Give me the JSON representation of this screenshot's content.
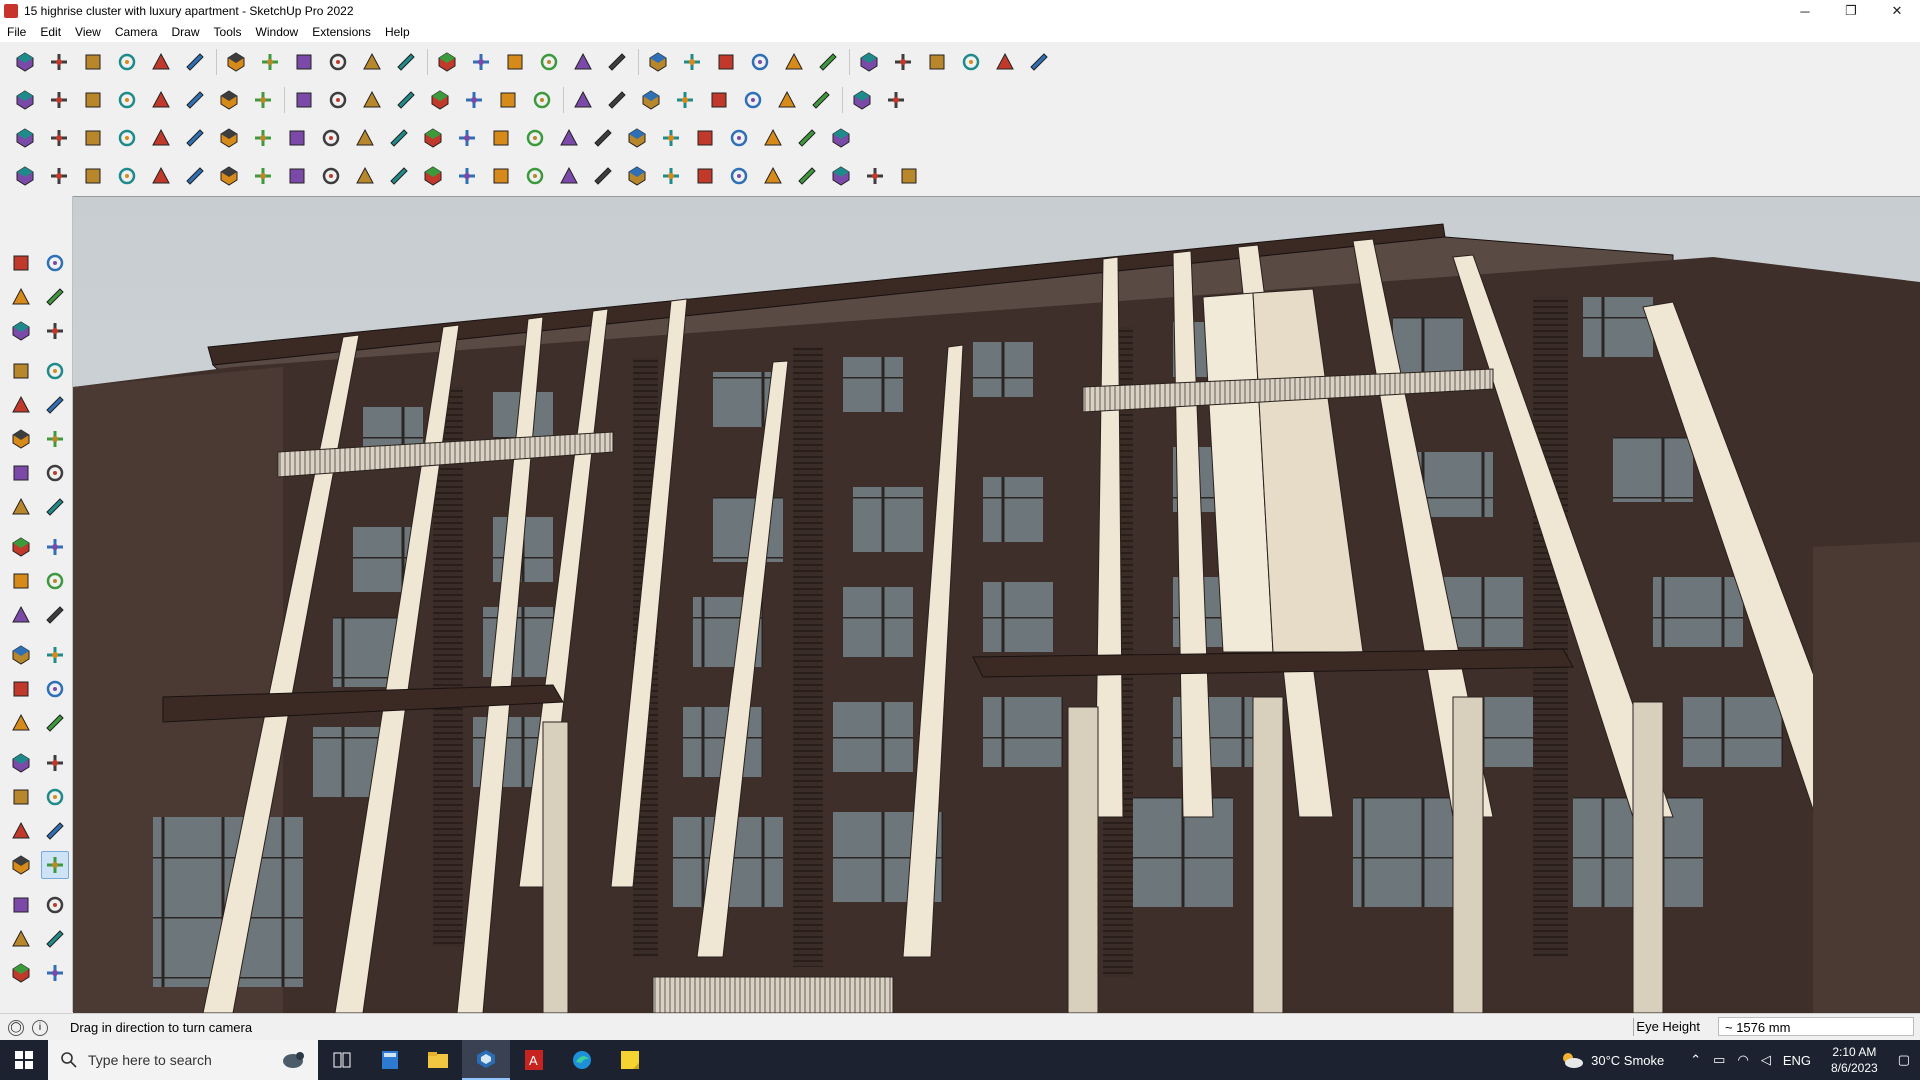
{
  "window": {
    "title": "15 highrise cluster with luxury apartment - SketchUp Pro 2022",
    "minimize_glyph": "─",
    "maximize_glyph": "❐",
    "close_glyph": "✕"
  },
  "menu": [
    "File",
    "Edit",
    "View",
    "Camera",
    "Draw",
    "Tools",
    "Window",
    "Extensions",
    "Help"
  ],
  "toolbar_icons": {
    "row1": [
      "zoom-icon",
      "select-icon",
      "eraser-icon",
      "pencil-icon",
      "lasso-icon",
      "rectangle-icon",
      "push-pull-icon",
      "follow-me-icon",
      "move-icon",
      "rotate-icon",
      "scale-icon",
      "tape-measure-icon",
      "text-icon",
      "paint-bucket-icon",
      "orbit-icon",
      "pan-icon",
      "zoom-window-icon",
      "zoom-extents-icon",
      "section-plane-icon",
      "section-display-icon",
      "layers-icon",
      "styles-icon",
      "components-icon",
      "geo-location-icon",
      "warehouse-icon",
      "extension-manager-icon",
      "send-to-layout-icon",
      "undo-icon",
      "redo-icon",
      "solid-tools-icon"
    ],
    "row2": [
      "iso-view-icon",
      "top-view-icon",
      "front-view-icon",
      "right-view-icon",
      "back-view-icon",
      "left-view-icon",
      "x-ray-icon",
      "wireframe-icon",
      "hidden-line-icon",
      "shaded-icon",
      "textured-icon",
      "monochrome-icon",
      "house-icon",
      "roof-icon",
      "garage-icon",
      "shadow-icon",
      "fog-icon",
      "circle-icon",
      "polygon-icon",
      "arc-icon",
      "curve-icon",
      "offset-icon",
      "intersect-icon",
      "subtract-icon",
      "split-icon",
      "trim-icon"
    ],
    "row3": [
      "cube-blue-icon",
      "plane-blue-icon",
      "plane-yellow-icon",
      "plane-green-icon",
      "plane-red-icon",
      "plane-white-icon",
      "fillet-icon",
      "chamfer-icon",
      "extrude-icon",
      "weld-icon",
      "joint-icon",
      "array-icon",
      "mirror-icon",
      "align-icon",
      "cone-icon",
      "pyramid-icon",
      "torus-icon",
      "helix-icon",
      "spiral-icon",
      "spring-icon",
      "gear-icon",
      "tool-icon",
      "tube-icon",
      "bezier-icon",
      "grid-icon"
    ],
    "row4": [
      "corner-icon",
      "curve-line-icon",
      "bucket-icon",
      "scissors-icon",
      "sphere-icon",
      "stack-icon",
      "wave-icon",
      "box-icon",
      "knot-icon",
      "hook-icon",
      "stairs-icon",
      "railing-icon",
      "window-tool-icon",
      "door-tool-icon",
      "fence-icon",
      "slab-icon",
      "beam-icon",
      "column-icon",
      "ramp-icon",
      "truss-icon",
      "roof-tool-icon",
      "facade-icon",
      "louver-icon",
      "shade-icon",
      "slat-icon",
      "panel-icon",
      "pattern-icon"
    ]
  },
  "side_icons": [
    "select-icon",
    "orbit-icon",
    "paint-bucket-icon",
    "eraser-icon",
    "component-icon",
    "tape-measure-icon",
    "line-icon",
    "freehand-icon",
    "rectangle-icon",
    "rotated-rectangle-icon",
    "circle-icon",
    "polygon-icon",
    "arc-icon",
    "pie-icon",
    "two-point-arc-icon",
    "three-point-arc-icon",
    "move-icon",
    "push-pull-icon",
    "rotate-icon",
    "follow-me-icon",
    "scale-icon",
    "offset-icon",
    "tape-icon",
    "dimension-icon",
    "protractor-icon",
    "text-icon",
    "axes-icon",
    "3d-text-icon",
    "orbit-nav-icon",
    "pan-icon",
    "zoom-icon",
    "zoom-window-icon",
    "zoom-extents-icon",
    "previous-view-icon",
    "position-camera-icon",
    "look-around-icon",
    "walk-icon",
    "section-icon",
    "section-plane-icon",
    "section-fill-icon",
    "layers-icon",
    "outliner-icon"
  ],
  "status": {
    "hint": "Drag in direction to turn camera",
    "eye_height_label": "Eye Height",
    "eye_height_value": "~ 1576 mm"
  },
  "taskbar": {
    "search_placeholder": "Type here to search",
    "weather": "30°C  Smoke",
    "language": "ENG",
    "time": "2:10 AM",
    "date": "8/6/2023"
  }
}
